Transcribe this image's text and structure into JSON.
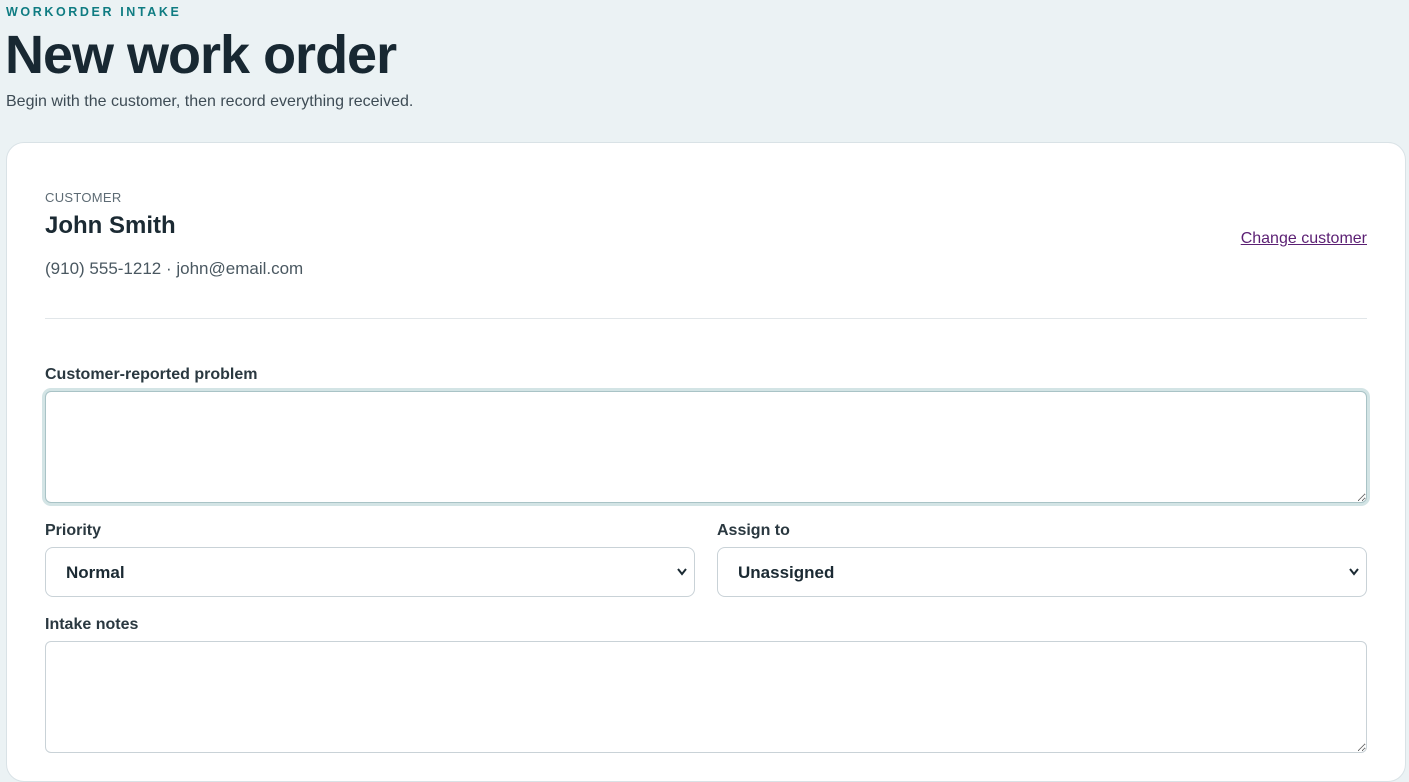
{
  "header": {
    "eyebrow": "WORKORDER INTAKE",
    "title": "New work order",
    "subtitle": "Begin with the customer, then record everything received."
  },
  "customer": {
    "section_label": "CUSTOMER",
    "name": "John Smith",
    "contact": "(910) 555-1212 · john@email.com",
    "change_label": "Change customer"
  },
  "form": {
    "problem_label": "Customer-reported problem",
    "problem_value": "",
    "priority_label": "Priority",
    "priority_value": "Normal",
    "assign_label": "Assign to",
    "assign_value": "Unassigned",
    "notes_label": "Intake notes",
    "notes_value": ""
  },
  "colors": {
    "accent": "#0f7c82",
    "link": "#5b1f73",
    "page_bg": "#ebf2f4"
  }
}
